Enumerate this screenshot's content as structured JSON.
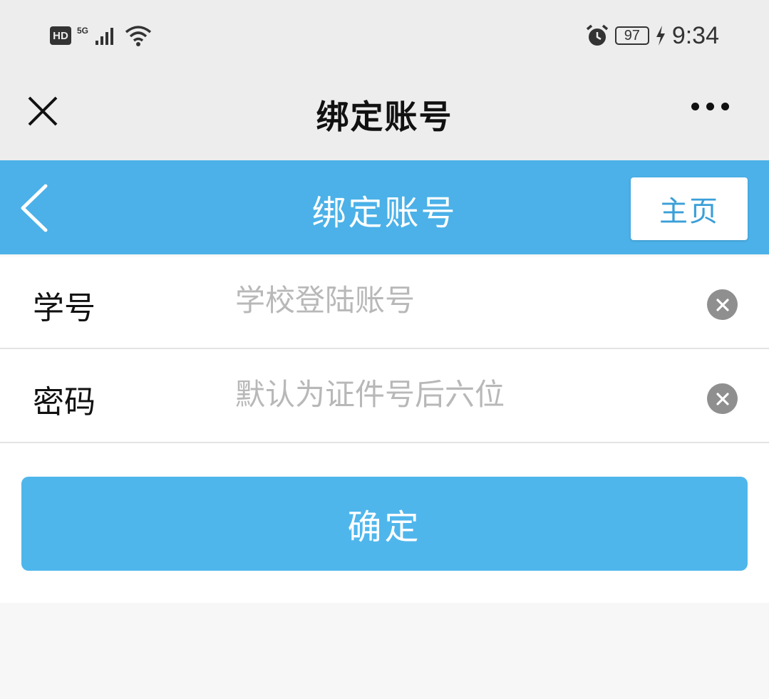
{
  "status_bar": {
    "hd": "HD",
    "network": "5G",
    "battery": "97",
    "time": "9:34",
    "icons": [
      "signal-icon",
      "wifi-icon",
      "alarm-icon",
      "battery-icon",
      "charging-icon"
    ]
  },
  "wechat_nav": {
    "title": "绑定账号",
    "icons": [
      "close-icon",
      "more-icon"
    ]
  },
  "header": {
    "title": "绑定账号",
    "home_label": "主页",
    "color": "#4bb1e8",
    "icons": [
      "back-chevron-icon"
    ]
  },
  "form": {
    "student_id": {
      "label": "学号",
      "placeholder": "学校登陆账号",
      "value": ""
    },
    "password": {
      "label": "密码",
      "placeholder": "默认为证件号后六位",
      "value": ""
    },
    "submit_label": "确定",
    "submit_color": "#4fb6ec",
    "icons": [
      "clear-icon"
    ]
  }
}
